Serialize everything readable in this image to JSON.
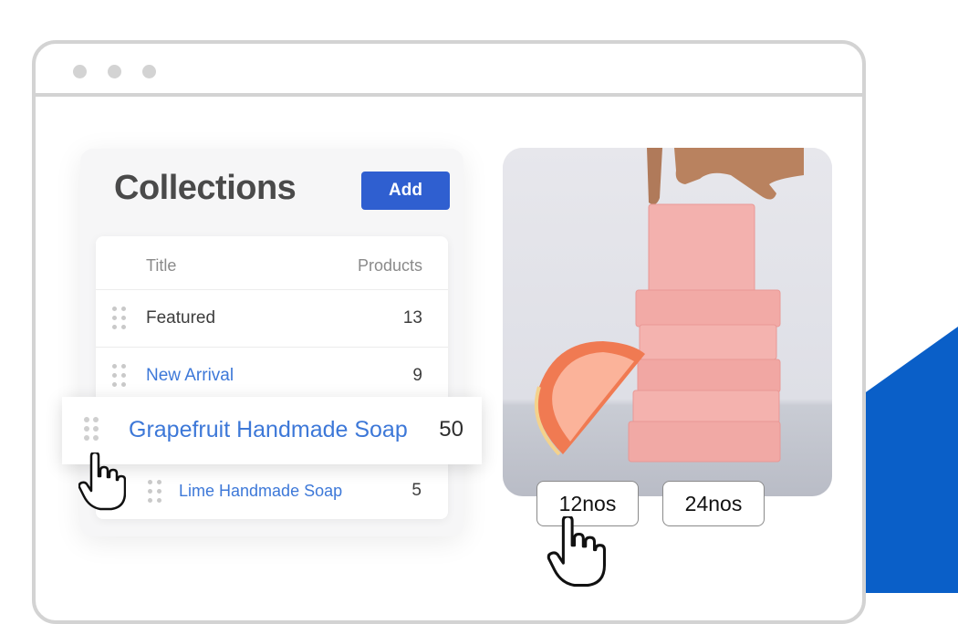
{
  "panel": {
    "title": "Collections",
    "add_label": "Add"
  },
  "table": {
    "headers": {
      "title": "Title",
      "products": "Products"
    },
    "rows": [
      {
        "label": "Featured",
        "count": "13"
      },
      {
        "label": "New Arrival",
        "count": "9"
      }
    ],
    "dragged": {
      "label": "Grapefruit Handmade Soap",
      "count": "50"
    },
    "after": {
      "label": "Lime Handmade Soap",
      "count": "5"
    }
  },
  "variants": [
    "12nos",
    "24nos"
  ],
  "colors": {
    "accent_blue": "#2f5fd0",
    "link_blue": "#3d78d8",
    "corner_blue": "#0a5fc8",
    "soap_pink": "#f2a9a6"
  },
  "icons": [
    "window-dot-icon",
    "drag-handle-icon",
    "hand-pointer-icon"
  ]
}
